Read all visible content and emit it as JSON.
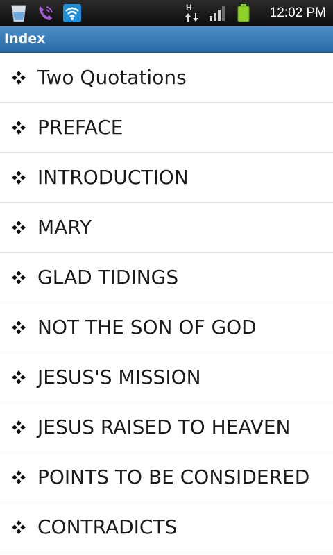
{
  "status_bar": {
    "time": "12:02 PM",
    "network_type": "H",
    "icons": [
      "cup-icon",
      "phone-icon",
      "wifi-icon",
      "data-arrows-icon",
      "signal-icon",
      "battery-icon"
    ]
  },
  "title_bar": {
    "title": "Index"
  },
  "index_items": [
    {
      "label": "Two Quotations"
    },
    {
      "label": "PREFACE"
    },
    {
      "label": "INTRODUCTION"
    },
    {
      "label": "MARY"
    },
    {
      "label": "GLAD TIDINGS"
    },
    {
      "label": "NOT THE SON OF GOD"
    },
    {
      "label": "JESUS'S MISSION"
    },
    {
      "label": "JESUS RAISED TO HEAVEN"
    },
    {
      "label": "POINTS TO BE CONSIDERED"
    },
    {
      "label": "CONTRADICTS"
    }
  ],
  "colors": {
    "status_bar": "#1a1a1a",
    "title_bar": "#3b7dbd",
    "wifi": "#29a3e8",
    "battery": "#8ed12a",
    "text": "#1a1a1a"
  }
}
